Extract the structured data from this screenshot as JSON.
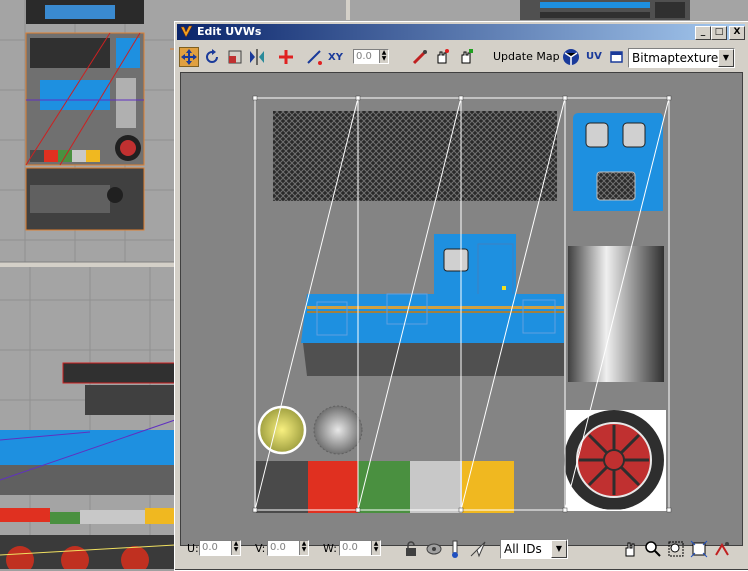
{
  "dialog": {
    "title": "Edit UVWs",
    "controls": {
      "minimize": "_",
      "maximize": "□",
      "close": "X"
    }
  },
  "toolbar": {
    "tools": [
      "move-icon",
      "rotate-icon",
      "scale-icon",
      "mirror-icon",
      "freeform-icon",
      "weld-icon",
      "xy-icon"
    ],
    "spin_value": "0.0",
    "update_map_label": "Update Map",
    "uv_label": "UV",
    "bitmap_select": "Bitmaptexture"
  },
  "status": {
    "u_label": "U:",
    "u_value": "0.0",
    "v_label": "V:",
    "v_value": "0.0",
    "w_label": "W:",
    "w_value": "0.0",
    "ids_select": "All IDs"
  },
  "colors": {
    "title_start": "#0a246a",
    "title_end": "#a6caf0",
    "loco_blue": "#1e90e0",
    "swatches": [
      "#4a4a4a",
      "#e03020",
      "#4a9040",
      "#c8c8c8",
      "#f0b820"
    ]
  }
}
